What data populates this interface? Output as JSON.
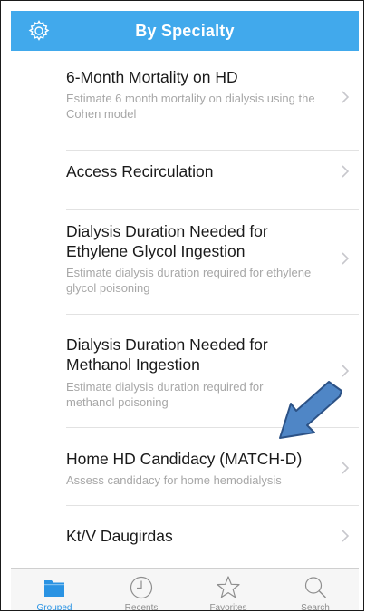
{
  "header": {
    "title": "By Specialty",
    "settings_icon": "gear-icon",
    "color": "#41a9ec"
  },
  "rows": [
    {
      "title": "6-Month Mortality on HD",
      "subtitle": "Estimate 6 month mortality on dialysis using the Cohen model"
    },
    {
      "title": "Access Recirculation",
      "subtitle": ""
    },
    {
      "title": "Dialysis Duration Needed for Ethylene Glycol Ingestion",
      "subtitle": "Estimate dialysis duration required for ethylene glycol poisoning"
    },
    {
      "title": "Dialysis Duration Needed for Methanol Ingestion",
      "subtitle": "Estimate dialysis duration required for methanol poisoning"
    },
    {
      "title": "Home HD Candidacy (MATCH-D)",
      "subtitle": "Assess candidacy for home hemodialysis"
    },
    {
      "title": "Kt/V Daugirdas",
      "subtitle": ""
    }
  ],
  "annotation": {
    "icon": "blue-arrow-pointer",
    "color": "#4f86c6"
  },
  "tabbar": {
    "active_color": "#2a93e3",
    "inactive_color": "#8e8e8e",
    "tabs": [
      {
        "label": "Grouped",
        "icon": "folder-icon",
        "active": true
      },
      {
        "label": "Recents",
        "icon": "clock-icon",
        "active": false
      },
      {
        "label": "Favorites",
        "icon": "star-icon",
        "active": false
      },
      {
        "label": "Search",
        "icon": "search-icon",
        "active": false
      }
    ]
  }
}
